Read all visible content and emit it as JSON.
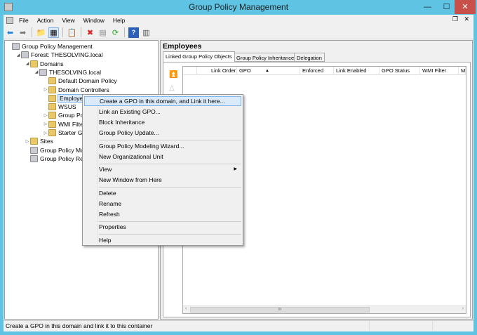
{
  "window": {
    "title": "Group Policy Management",
    "minimize": "—",
    "maximize": "☐",
    "close": "✕"
  },
  "menubar": [
    "File",
    "Action",
    "View",
    "Window",
    "Help"
  ],
  "tree": [
    {
      "label": "Group Policy Management",
      "level": 0,
      "exp": ""
    },
    {
      "label": "Forest: THESOLVING.local",
      "level": 1,
      "exp": "◢"
    },
    {
      "label": "Domains",
      "level": 2,
      "exp": "◢"
    },
    {
      "label": "THESOLVING.local",
      "level": 3,
      "exp": "◢"
    },
    {
      "label": "Default Domain Policy",
      "level": 4,
      "exp": ""
    },
    {
      "label": "Domain Controllers",
      "level": 4,
      "exp": "▷"
    },
    {
      "label": "Employees",
      "level": 4,
      "exp": "",
      "selected": true
    },
    {
      "label": "WSUS",
      "level": 4,
      "exp": ""
    },
    {
      "label": "Group Policy Objects",
      "level": 4,
      "exp": "▷"
    },
    {
      "label": "WMI Filters",
      "level": 4,
      "exp": "▷"
    },
    {
      "label": "Starter GPOs",
      "level": 4,
      "exp": "▷"
    },
    {
      "label": "Sites",
      "level": 2,
      "exp": "▷"
    },
    {
      "label": "Group Policy Modeling",
      "level": 2,
      "exp": ""
    },
    {
      "label": "Group Policy Results",
      "level": 2,
      "exp": ""
    }
  ],
  "right": {
    "title": "Employees",
    "tabs": [
      "Linked Group Policy Objects",
      "Group Policy Inheritance",
      "Delegation"
    ],
    "columns": [
      "Link Order",
      "GPO",
      "Enforced",
      "Link Enabled",
      "GPO Status",
      "WMI Filter",
      "Modified"
    ],
    "sort_indicator": "▲",
    "scroll_grip": "III"
  },
  "context_menu": [
    {
      "label": "Create a GPO in this domain, and Link it here...",
      "highlighted": true
    },
    {
      "label": "Link an Existing GPO..."
    },
    {
      "label": "Block Inheritance"
    },
    {
      "label": "Group Policy Update..."
    },
    {
      "sep": true
    },
    {
      "label": "Group Policy Modeling Wizard..."
    },
    {
      "label": "New Organizational Unit"
    },
    {
      "sep": true
    },
    {
      "label": "View",
      "submenu": true
    },
    {
      "label": "New Window from Here"
    },
    {
      "sep": true
    },
    {
      "label": "Delete"
    },
    {
      "label": "Rename"
    },
    {
      "label": "Refresh"
    },
    {
      "sep": true
    },
    {
      "label": "Properties"
    },
    {
      "sep": true
    },
    {
      "label": "Help"
    }
  ],
  "status": "Create a GPO in this domain and link it to this container"
}
